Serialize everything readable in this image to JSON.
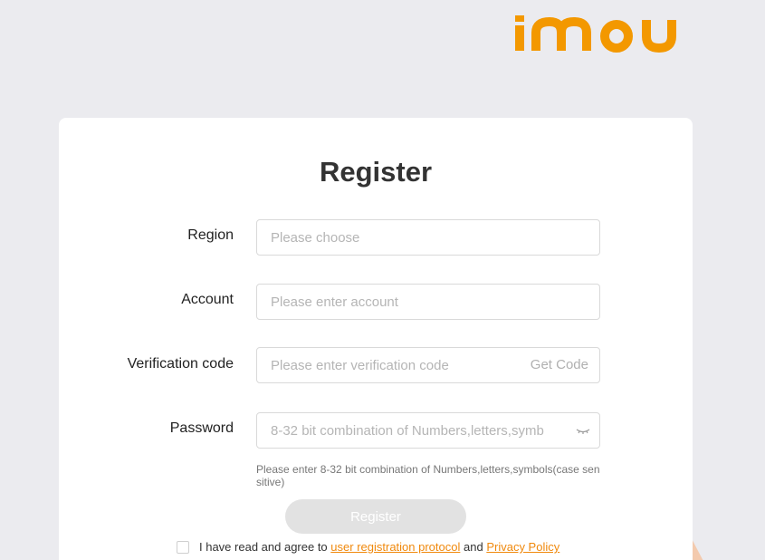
{
  "brand": {
    "logo_text": "imou",
    "accent_color": "#f39800"
  },
  "form": {
    "title": "Register",
    "region": {
      "label": "Region",
      "placeholder": "Please choose"
    },
    "account": {
      "label": "Account",
      "placeholder": "Please enter account"
    },
    "verification": {
      "label": "Verification code",
      "placeholder": "Please enter verification code",
      "get_code_label": "Get Code"
    },
    "password": {
      "label": "Password",
      "placeholder": "8-32 bit combination of Numbers,letters,symb",
      "toggle_icon": "eye-closed-icon"
    },
    "password_hint": "Please enter 8-32 bit combination of Numbers,letters,symbols(case sensitive)",
    "submit_label": "Register",
    "agreement": {
      "checked": false,
      "prefix": "I have read and agree to",
      "protocol_link": "user registration protocol",
      "conjunction": "and",
      "privacy_link": "Privacy Policy"
    }
  }
}
